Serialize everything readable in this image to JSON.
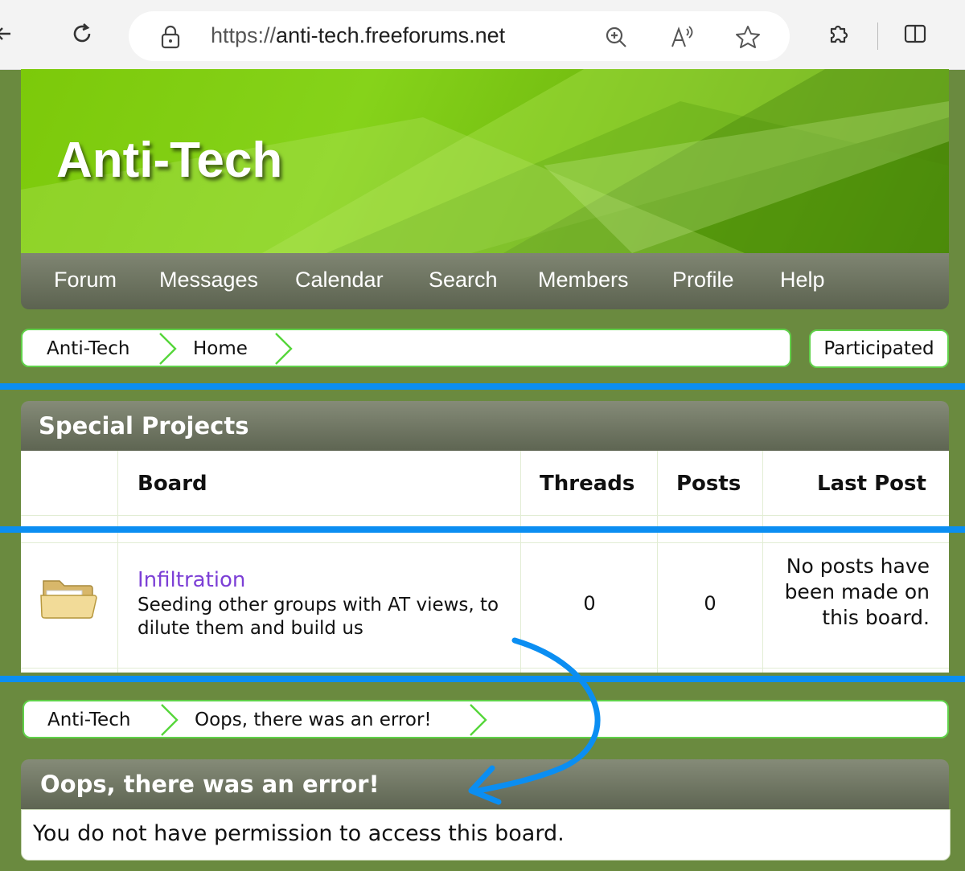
{
  "browser": {
    "url_scheme": "https://",
    "url_host": "anti-tech.freeforums.net"
  },
  "site": {
    "title": "Anti-Tech"
  },
  "menu": {
    "items": [
      "Forum",
      "Messages",
      "Calendar",
      "Search",
      "Members",
      "Profile",
      "Help"
    ]
  },
  "breadcrumb_top": {
    "items": [
      "Anti-Tech",
      "Home"
    ],
    "participated_label": "Participated"
  },
  "category": {
    "title": "Special Projects",
    "columns": {
      "board": "Board",
      "threads": "Threads",
      "posts": "Posts",
      "last_post": "Last Post"
    },
    "boards": [
      {
        "name": "Infiltration",
        "description": "Seeding other groups with AT views, to dilute them and build us",
        "threads": "0",
        "posts": "0",
        "last_post": "No posts have been made on this board."
      }
    ]
  },
  "breadcrumb_bottom": {
    "items": [
      "Anti-Tech",
      "Oops, there was an error!"
    ]
  },
  "error": {
    "title": "Oops, there was an error!",
    "message": "You do not have permission to access this board."
  },
  "colors": {
    "accent_green": "#60d14a",
    "annotation_blue": "#0b8ef2",
    "link_purple": "#7c3fd6"
  }
}
